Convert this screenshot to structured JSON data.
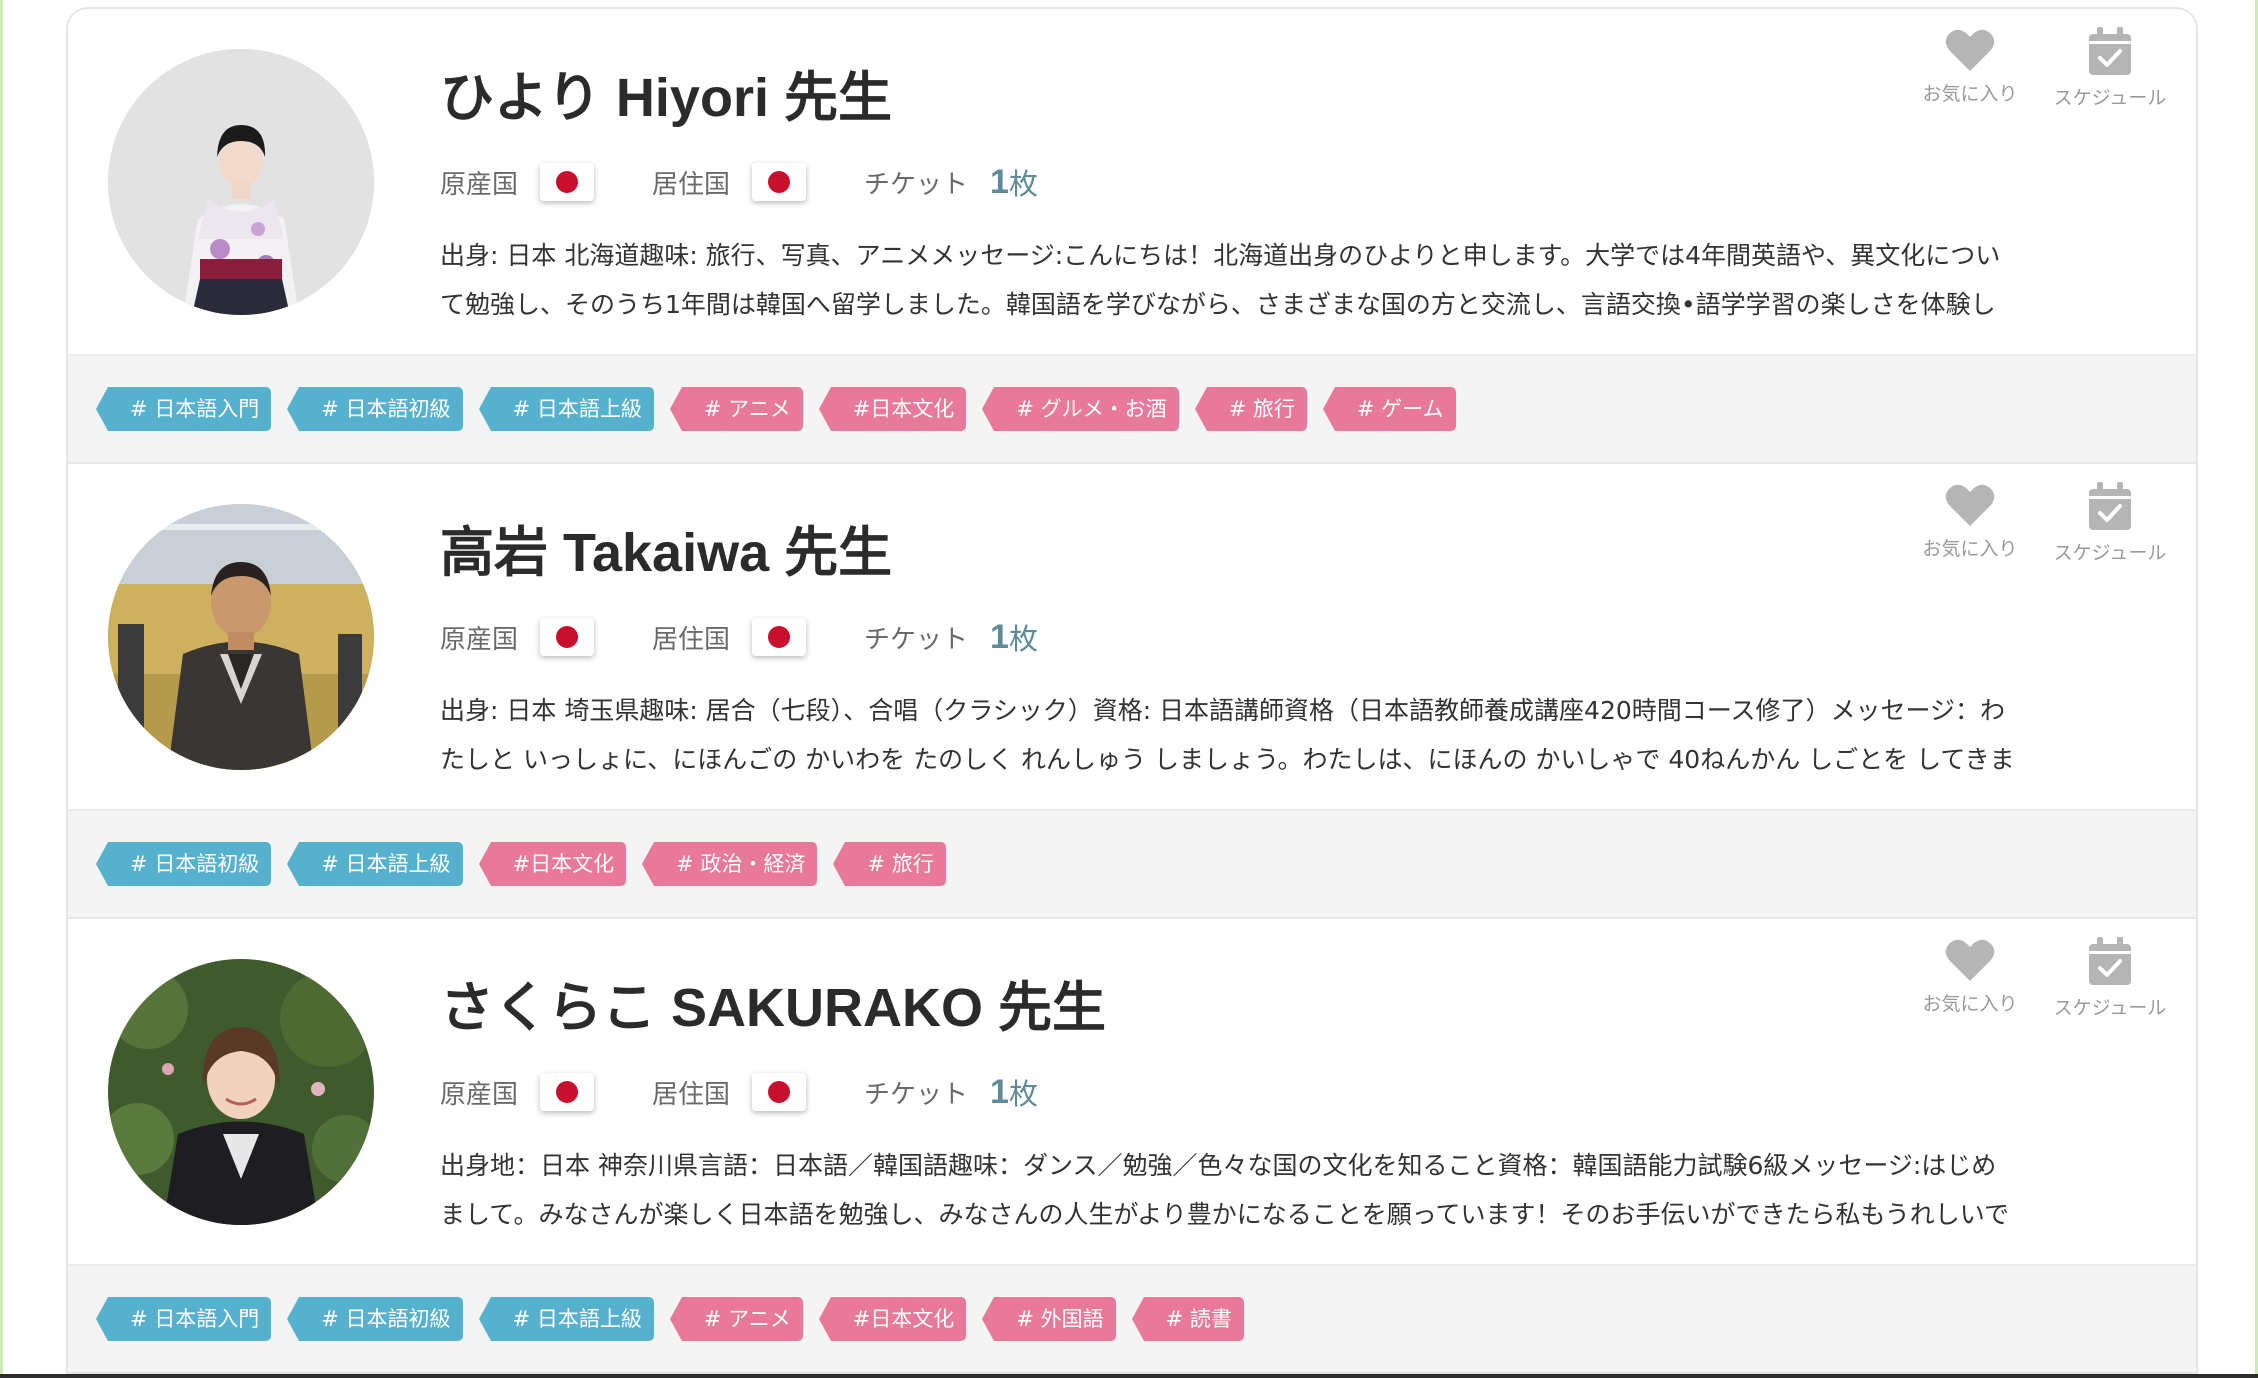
{
  "labels": {
    "origin": "原産国",
    "residence": "居住国",
    "ticket": "チケット",
    "ticket_unit": "枚",
    "favorite": "お気に入り",
    "schedule": "スケジュール"
  },
  "teachers": [
    {
      "name": "ひより Hiyori 先生",
      "origin_flag": "japan-flag",
      "residence_flag": "japan-flag",
      "ticket_count": "1",
      "bio_line1": "出身: 日本 北海道趣味: 旅行、写真、アニメメッセージ:こんにちは！北海道出身のひよりと申します。大学では4年間英語や、異文化につい",
      "bio_line2": "て勉強し、そのうち1年間は韓国へ留学しました。韓国語を学びながら、さまざまな国の方と交流し、言語交換•語学学習の楽しさを体験し",
      "tags": [
        {
          "label": "# 日本語入門",
          "color": "blue"
        },
        {
          "label": "# 日本語初級",
          "color": "blue"
        },
        {
          "label": "# 日本語上級",
          "color": "blue"
        },
        {
          "label": "# アニメ",
          "color": "pink"
        },
        {
          "label": "#日本文化",
          "color": "pink"
        },
        {
          "label": "# グルメ・お酒",
          "color": "pink"
        },
        {
          "label": "# 旅行",
          "color": "pink"
        },
        {
          "label": "# ゲーム",
          "color": "pink"
        }
      ]
    },
    {
      "name": "高岩 Takaiwa 先生",
      "origin_flag": "japan-flag",
      "residence_flag": "japan-flag",
      "ticket_count": "1",
      "bio_line1": "出身: 日本 埼玉県趣味: 居合（七段）、合唱（クラシック）資格: 日本語講師資格（日本語教師養成講座420時間コース修了）メッセージ：わ",
      "bio_line2": "たしと いっしょに、にほんごの かいわを たのしく れんしゅう しましょう。わたしは、にほんの かいしゃで 40ねんかん しごとを してきま",
      "tags": [
        {
          "label": "# 日本語初級",
          "color": "blue"
        },
        {
          "label": "# 日本語上級",
          "color": "blue"
        },
        {
          "label": "#日本文化",
          "color": "pink"
        },
        {
          "label": "# 政治・経済",
          "color": "pink"
        },
        {
          "label": "# 旅行",
          "color": "pink"
        }
      ]
    },
    {
      "name": "さくらこ SAKURAKO 先生",
      "origin_flag": "japan-flag",
      "residence_flag": "japan-flag",
      "ticket_count": "1",
      "bio_line1": "出身地：日本 神奈川県言語：日本語／韓国語趣味：ダンス／勉強／色々な国の文化を知ること資格：韓国語能力試験6級メッセージ:はじめ",
      "bio_line2": "まして。みなさんが楽しく日本語を勉強し、みなさんの人生がより豊かになることを願っています！そのお手伝いができたら私もうれしいで",
      "tags": [
        {
          "label": "# 日本語入門",
          "color": "blue"
        },
        {
          "label": "# 日本語初級",
          "color": "blue"
        },
        {
          "label": "# 日本語上級",
          "color": "blue"
        },
        {
          "label": "# アニメ",
          "color": "pink"
        },
        {
          "label": "#日本文化",
          "color": "pink"
        },
        {
          "label": "# 外国語",
          "color": "pink"
        },
        {
          "label": "# 読書",
          "color": "pink"
        }
      ]
    }
  ],
  "colors": {
    "tag_blue": "#56b1cf",
    "tag_pink": "#e9799b",
    "ticket_accent": "#5e8a9a",
    "icon_gray": "#b5b5b5"
  }
}
